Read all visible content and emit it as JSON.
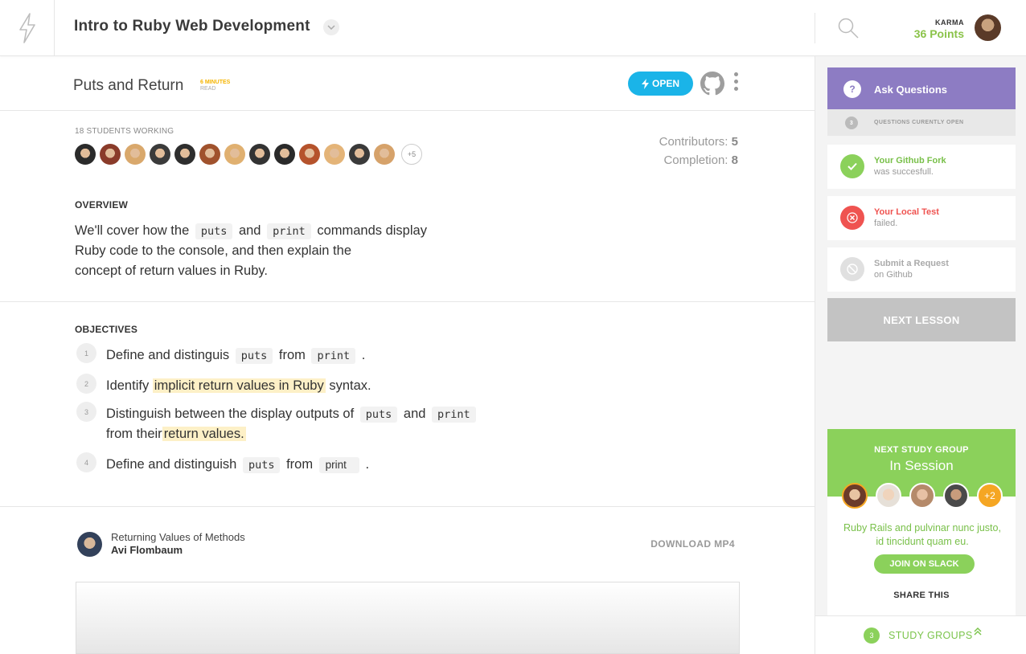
{
  "header": {
    "course_title": "Intro to Ruby Web Development",
    "karma_label": "KARMA",
    "karma_points": "36 Points"
  },
  "lesson": {
    "title": "Puts and Return",
    "minutes": "6 MINUTES",
    "read": "READ",
    "open_label": "OPEN"
  },
  "students": {
    "label": "18 STUDENTS WORKING",
    "more": "+5",
    "avatar_colors": [
      "#2b2b2b",
      "#8a3b2a",
      "#d9a86c",
      "#3b3b3b",
      "#2e2e2e",
      "#a0522d",
      "#e0b070",
      "#333333",
      "#2a2a2a",
      "#b5532c",
      "#e4b478",
      "#3a3a3a",
      "#d6a26a"
    ]
  },
  "stats": {
    "contributors_label": "Contributors:",
    "contributors_value": "5",
    "completion_label": "Completion:",
    "completion_value": "8"
  },
  "overview": {
    "label": "OVERVIEW",
    "p1": "We'll cover how the",
    "code1": "puts",
    "p2": "and",
    "code2": "print",
    "p3": "commands display",
    "p4": "Ruby code to the  console, and then explain the",
    "p5": "concept of return values in Ruby."
  },
  "objectives": {
    "label": "OBJECTIVES",
    "items": [
      {
        "num": "1",
        "a": "Define and distinguis",
        "c1": "puts",
        "b": "from",
        "c2": "print",
        "end": "."
      },
      {
        "num": "2",
        "a": "Identify",
        "hl": "implicit return values in Ruby",
        "end": "syntax."
      },
      {
        "num": "3",
        "a": "Distinguish between the display outputs of",
        "c1": "puts",
        "b": "and",
        "c2": "print",
        "line2": "from their",
        "hl": "return values."
      },
      {
        "num": "4",
        "a": "Define and distinguish",
        "c1": "puts",
        "b": "from",
        "c2": "print",
        "end": "."
      }
    ]
  },
  "video": {
    "title": "Returning Values of Methods",
    "author": "Avi Flombaum",
    "download": "DOWNLOAD MP4"
  },
  "sidebar": {
    "ask_label": "Ask Questions",
    "ask_icon": "?",
    "open_count": "3",
    "open_text": "QUESTIONS CURENTLY OPEN",
    "cards": [
      {
        "title": "Your Github Fork",
        "sub": "was succesfull.",
        "color": "#8bd15b",
        "title_color": "#79c04a",
        "icon": "check-icon"
      },
      {
        "title": "Your Local Test",
        "sub": "failed.",
        "color": "#ef5350",
        "title_color": "#ef5350",
        "icon": "close-icon"
      },
      {
        "title": "Submit a Request",
        "sub": "on Github",
        "color": "#e0e0e0",
        "title_color": "#aaaaaa",
        "icon": "block-icon"
      }
    ],
    "next_lesson": "NEXT LESSON"
  },
  "study_group": {
    "label": "NEXT STUDY GROUP",
    "title": "In Session",
    "more": "+2",
    "desc": "Ruby Rails and pulvinar nunc justo, id tincidunt quam eu.",
    "slack": "JOIN ON SLACK",
    "share": "SHARE THIS",
    "footer_count": "3",
    "footer_label": "STUDY GROUPS"
  }
}
